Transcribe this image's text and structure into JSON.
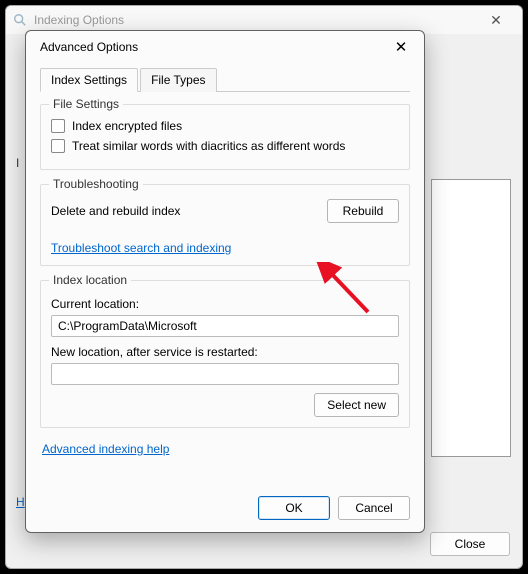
{
  "parent": {
    "title": "Indexing Options",
    "label_i_fragment": "I",
    "label_h_fragment": "H",
    "close_button": "Close"
  },
  "dialog": {
    "title": "Advanced Options",
    "tabs": {
      "index_settings": "Index Settings",
      "file_types": "File Types"
    },
    "file_settings": {
      "legend": "File Settings",
      "index_encrypted": "Index encrypted files",
      "treat_similar": "Treat similar words with diacritics as different words"
    },
    "troubleshooting": {
      "legend": "Troubleshooting",
      "delete_rebuild_label": "Delete and rebuild index",
      "rebuild_button": "Rebuild",
      "troubleshoot_link": "Troubleshoot search and indexing"
    },
    "index_location": {
      "legend": "Index location",
      "current_label": "Current location:",
      "current_value": "C:\\ProgramData\\Microsoft",
      "new_label": "New location, after service is restarted:",
      "new_value": "",
      "select_new_button": "Select new"
    },
    "help_link": "Advanced indexing help",
    "ok_button": "OK",
    "cancel_button": "Cancel"
  }
}
